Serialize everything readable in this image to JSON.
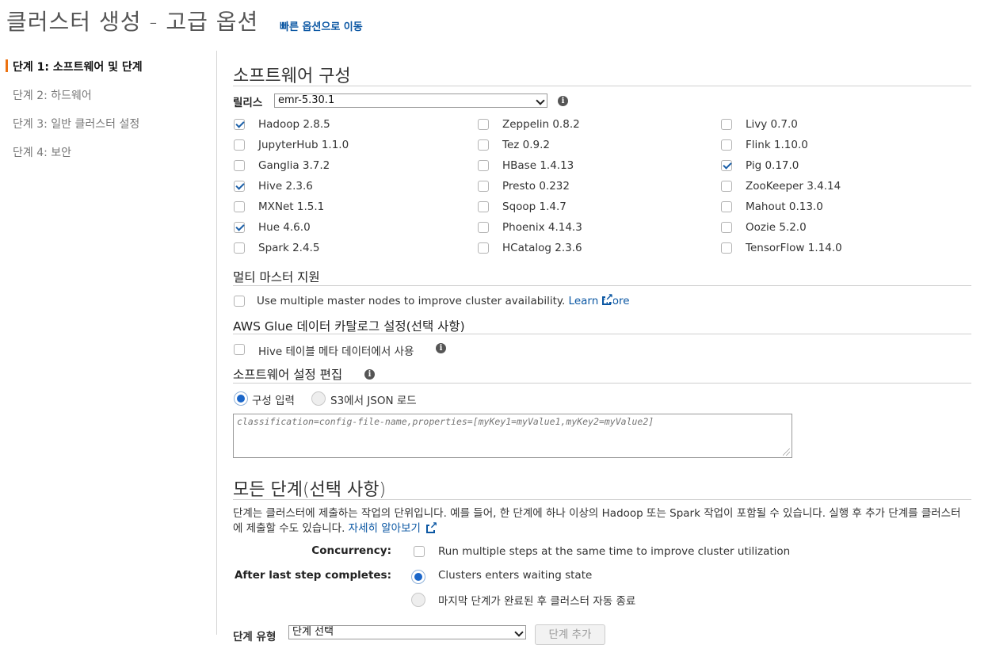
{
  "header": {
    "title": "클러스터 생성 - 고급 옵션",
    "quick_link": "빠른 옵션으로 이동"
  },
  "sidebar": {
    "steps": [
      {
        "label": "단계 1: 소프트웨어 및 단계",
        "active": true
      },
      {
        "label": "단계 2: 하드웨어",
        "active": false
      },
      {
        "label": "단계 3: 일반 클러스터 설정",
        "active": false
      },
      {
        "label": "단계 4: 보안",
        "active": false
      }
    ]
  },
  "software": {
    "heading": "소프트웨어 구성",
    "release_label": "릴리스",
    "release_value": "emr-5.30.1",
    "apps": [
      {
        "label": "Hadoop 2.8.5",
        "checked": true
      },
      {
        "label": "Zeppelin 0.8.2",
        "checked": false
      },
      {
        "label": "Livy 0.7.0",
        "checked": false
      },
      {
        "label": "JupyterHub 1.1.0",
        "checked": false
      },
      {
        "label": "Tez 0.9.2",
        "checked": false
      },
      {
        "label": "Flink 1.10.0",
        "checked": false
      },
      {
        "label": "Ganglia 3.7.2",
        "checked": false
      },
      {
        "label": "HBase 1.4.13",
        "checked": false
      },
      {
        "label": "Pig 0.17.0",
        "checked": true
      },
      {
        "label": "Hive 2.3.6",
        "checked": true
      },
      {
        "label": "Presto 0.232",
        "checked": false
      },
      {
        "label": "ZooKeeper 3.4.14",
        "checked": false
      },
      {
        "label": "MXNet 1.5.1",
        "checked": false
      },
      {
        "label": "Sqoop 1.4.7",
        "checked": false
      },
      {
        "label": "Mahout 0.13.0",
        "checked": false
      },
      {
        "label": "Hue 4.6.0",
        "checked": true
      },
      {
        "label": "Phoenix 4.14.3",
        "checked": false
      },
      {
        "label": "Oozie 5.2.0",
        "checked": false
      },
      {
        "label": "Spark 2.4.5",
        "checked": false
      },
      {
        "label": "HCatalog 2.3.6",
        "checked": false
      },
      {
        "label": "TensorFlow 1.14.0",
        "checked": false
      }
    ]
  },
  "multi_master": {
    "heading": "멀티 마스터 지원",
    "checkbox_label": "Use multiple master nodes to improve cluster availability.",
    "learn_more": "Learn more"
  },
  "glue": {
    "heading": "AWS Glue 데이터 카탈로그 설정(선택 사항)",
    "checkbox_label": "Hive 테이블 메타 데이터에서 사용"
  },
  "config_edit": {
    "heading": "소프트웨어 설정 편집",
    "radio_input": "구성 입력",
    "radio_s3": "S3에서 JSON 로드",
    "placeholder": "classification=config-file-name,properties=[myKey1=myValue1,myKey2=myValue2]"
  },
  "steps_section": {
    "heading": "모든 단계(선택 사항)",
    "description": "단계는 클러스터에 제출하는 작업의 단위입니다. 예를 들어, 한 단계에 하나 이상의 Hadoop 또는 Spark 작업이 포함될 수 있습니다. 실행 후 추가 단계를 클러스터에 제출할 수도 있습니다.",
    "learn_more": "자세히 알아보기",
    "concurrency_label": "Concurrency:",
    "concurrency_option": "Run multiple steps at the same time to improve cluster utilization",
    "after_last_label": "After last step completes:",
    "after_option_wait": "Clusters enters waiting state",
    "after_option_terminate": "마지막 단계가 완료된 후 클러스터 자동 종료",
    "step_type_label": "단계 유형",
    "step_type_value": "단계 선택",
    "add_step_button": "단계 추가"
  }
}
